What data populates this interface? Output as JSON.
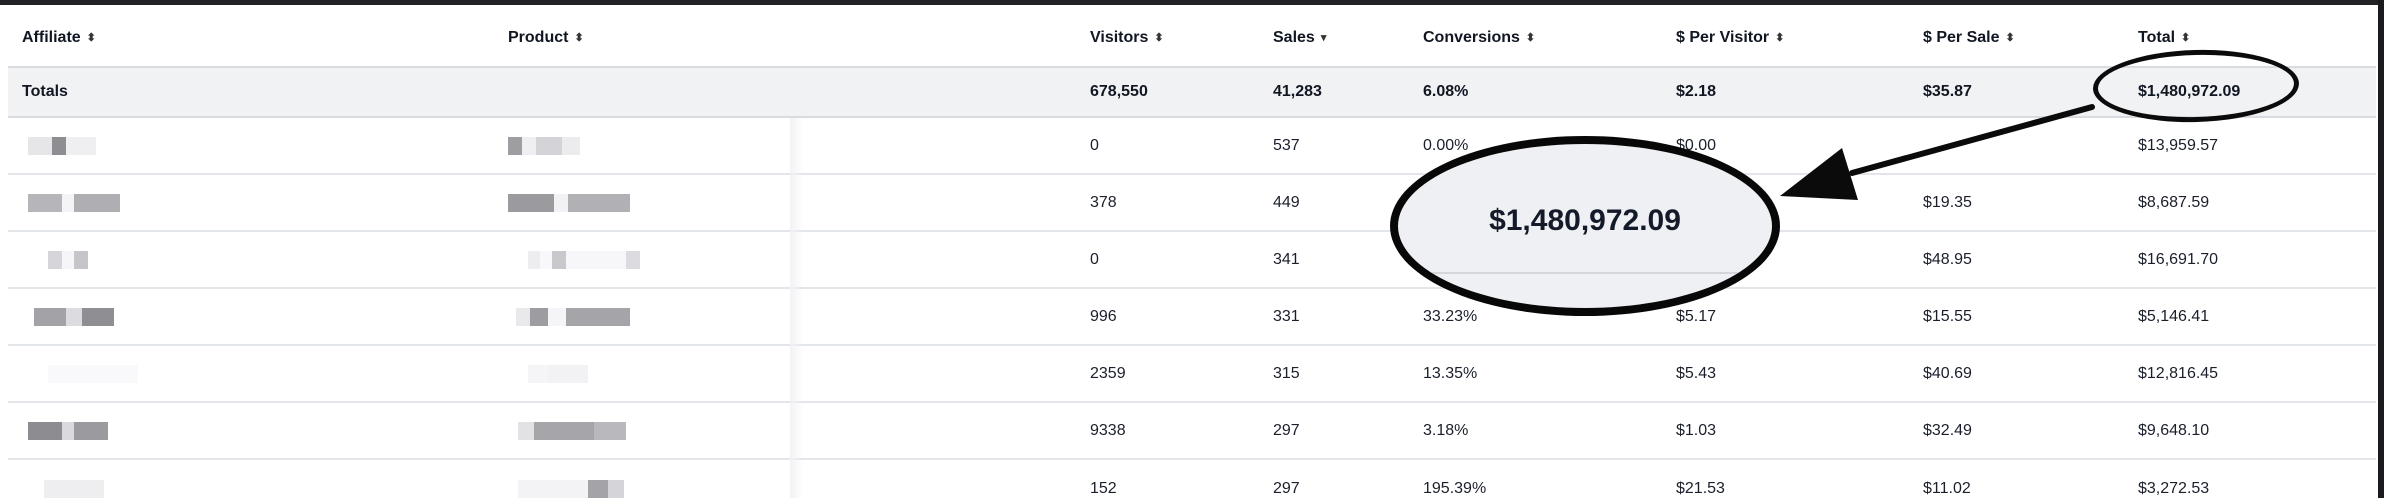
{
  "table": {
    "columns": [
      {
        "key": "affiliate",
        "label": "Affiliate",
        "sort": "⬍"
      },
      {
        "key": "product",
        "label": "Product",
        "sort": "⬍"
      },
      {
        "key": "visitors",
        "label": "Visitors",
        "sort": "⬍"
      },
      {
        "key": "sales",
        "label": "Sales",
        "sort": "▾"
      },
      {
        "key": "conversions",
        "label": "Conversions",
        "sort": "⬍"
      },
      {
        "key": "per_visitor",
        "label": "$ Per Visitor",
        "sort": "⬍"
      },
      {
        "key": "per_sale",
        "label": "$ Per Sale",
        "sort": "⬍"
      },
      {
        "key": "total",
        "label": "Total",
        "sort": "⬍"
      }
    ],
    "totals": {
      "label": "Totals",
      "visitors": "678,550",
      "sales": "41,283",
      "conversions": "6.08%",
      "per_visitor": "$2.18",
      "per_sale": "$35.87",
      "total": "$1,480,972.09"
    },
    "rows": [
      {
        "visitors": "0",
        "sales": "537",
        "conversions": "0.00%",
        "per_visitor": "$0.00",
        "per_sale": "",
        "total": "$13,959.57"
      },
      {
        "visitors": "378",
        "sales": "449",
        "conversions": "",
        "per_visitor": "",
        "per_sale": "$19.35",
        "total": "$8,687.59"
      },
      {
        "visitors": "0",
        "sales": "341",
        "conversions": "",
        "per_visitor": "",
        "per_sale": "$48.95",
        "total": "$16,691.70"
      },
      {
        "visitors": "996",
        "sales": "331",
        "conversions": "33.23%",
        "per_visitor": "$5.17",
        "per_sale": "$15.55",
        "total": "$5,146.41"
      },
      {
        "visitors": "2359",
        "sales": "315",
        "conversions": "13.35%",
        "per_visitor": "$5.43",
        "per_sale": "$40.69",
        "total": "$12,816.45"
      },
      {
        "visitors": "9338",
        "sales": "297",
        "conversions": "3.18%",
        "per_visitor": "$1.03",
        "per_sale": "$32.49",
        "total": "$9,648.10"
      },
      {
        "visitors": "152",
        "sales": "297",
        "conversions": "195.39%",
        "per_visitor": "$21.53",
        "per_sale": "$11.02",
        "total": "$3,272.53"
      }
    ]
  },
  "callout": {
    "zoom_value": "$1,480,972.09",
    "outline_color": "#0b0b0b"
  },
  "icons": {
    "sort": "sort-icon",
    "sort_desc": "sort-desc-icon",
    "arrow": "callout-arrow-icon"
  }
}
